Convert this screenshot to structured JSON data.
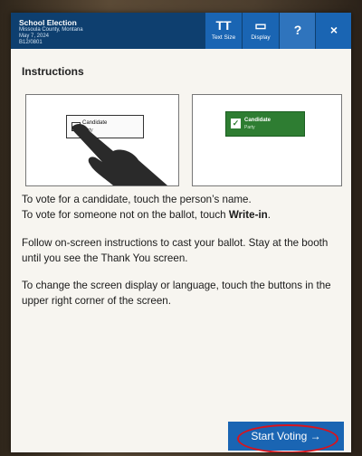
{
  "header": {
    "title": "School Election",
    "county": "Missoula County, Montana",
    "date": "May 7, 2024",
    "code": "B12/0801"
  },
  "toolbar": {
    "text_size_glyph": "TT",
    "text_size_label": "Text Size",
    "display_glyph": "▭",
    "display_label": "Display",
    "help_glyph": "?",
    "close_glyph": "×"
  },
  "main": {
    "heading": "Instructions",
    "illustration_left": {
      "candidate": "Candidate",
      "party": "Party"
    },
    "illustration_right": {
      "candidate": "Candidate",
      "party": "Party"
    },
    "line1": "To vote for a candidate, touch the person’s name.",
    "line2_prefix": "To vote for someone not on the ballot, touch ",
    "line2_bold": "Write-in",
    "line2_suffix": ".",
    "para2": "Follow on-screen instructions to cast your ballot. Stay at the booth until you see the Thank You screen.",
    "para3": "To change the screen display or language, touch the buttons in the upper right corner of the screen."
  },
  "footer": {
    "start_label": "Start Voting →"
  },
  "colors": {
    "topbar": "#0e3f6f",
    "button": "#1a65b3",
    "selected": "#2e7d32",
    "highlight_ring": "#d8141d"
  }
}
